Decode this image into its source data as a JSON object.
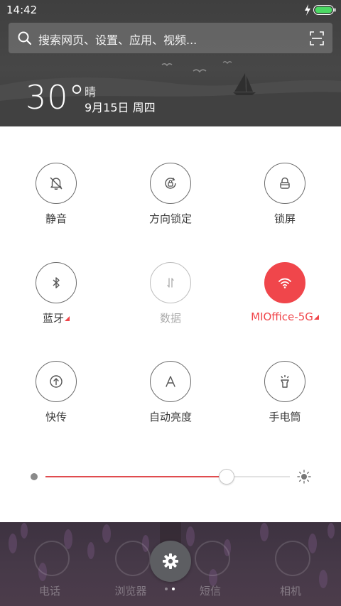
{
  "status_bar": {
    "time": "14:42",
    "battery_color": "#4cd964"
  },
  "search": {
    "placeholder": "搜索网页、设置、应用、视频..."
  },
  "weather": {
    "temperature": "30°",
    "condition": "晴",
    "date": "9月15日 周四"
  },
  "toggles": [
    {
      "label": "静音",
      "icon": "bell-off-icon",
      "state": "off"
    },
    {
      "label": "方向锁定",
      "icon": "rotation-lock-icon",
      "state": "off"
    },
    {
      "label": "锁屏",
      "icon": "lock-icon",
      "state": "off"
    },
    {
      "label": "蓝牙",
      "icon": "bluetooth-icon",
      "state": "off",
      "has_menu": true
    },
    {
      "label": "数据",
      "icon": "data-arrows-icon",
      "state": "disabled"
    },
    {
      "label": "MIOffice-5G",
      "icon": "wifi-icon",
      "state": "on",
      "has_menu": true
    },
    {
      "label": "快传",
      "icon": "quick-transfer-icon",
      "state": "off"
    },
    {
      "label": "自动亮度",
      "icon": "auto-brightness-icon",
      "state": "off"
    },
    {
      "label": "手电筒",
      "icon": "flashlight-icon",
      "state": "off"
    }
  ],
  "brightness": {
    "level": 0.74
  },
  "dock": {
    "apps": [
      "电话",
      "浏览器",
      "短信",
      "相机"
    ]
  },
  "pager": {
    "count": 2,
    "active": 1
  },
  "colors": {
    "accent": "#f0464b",
    "header": "#434343",
    "dock": "#463948"
  }
}
